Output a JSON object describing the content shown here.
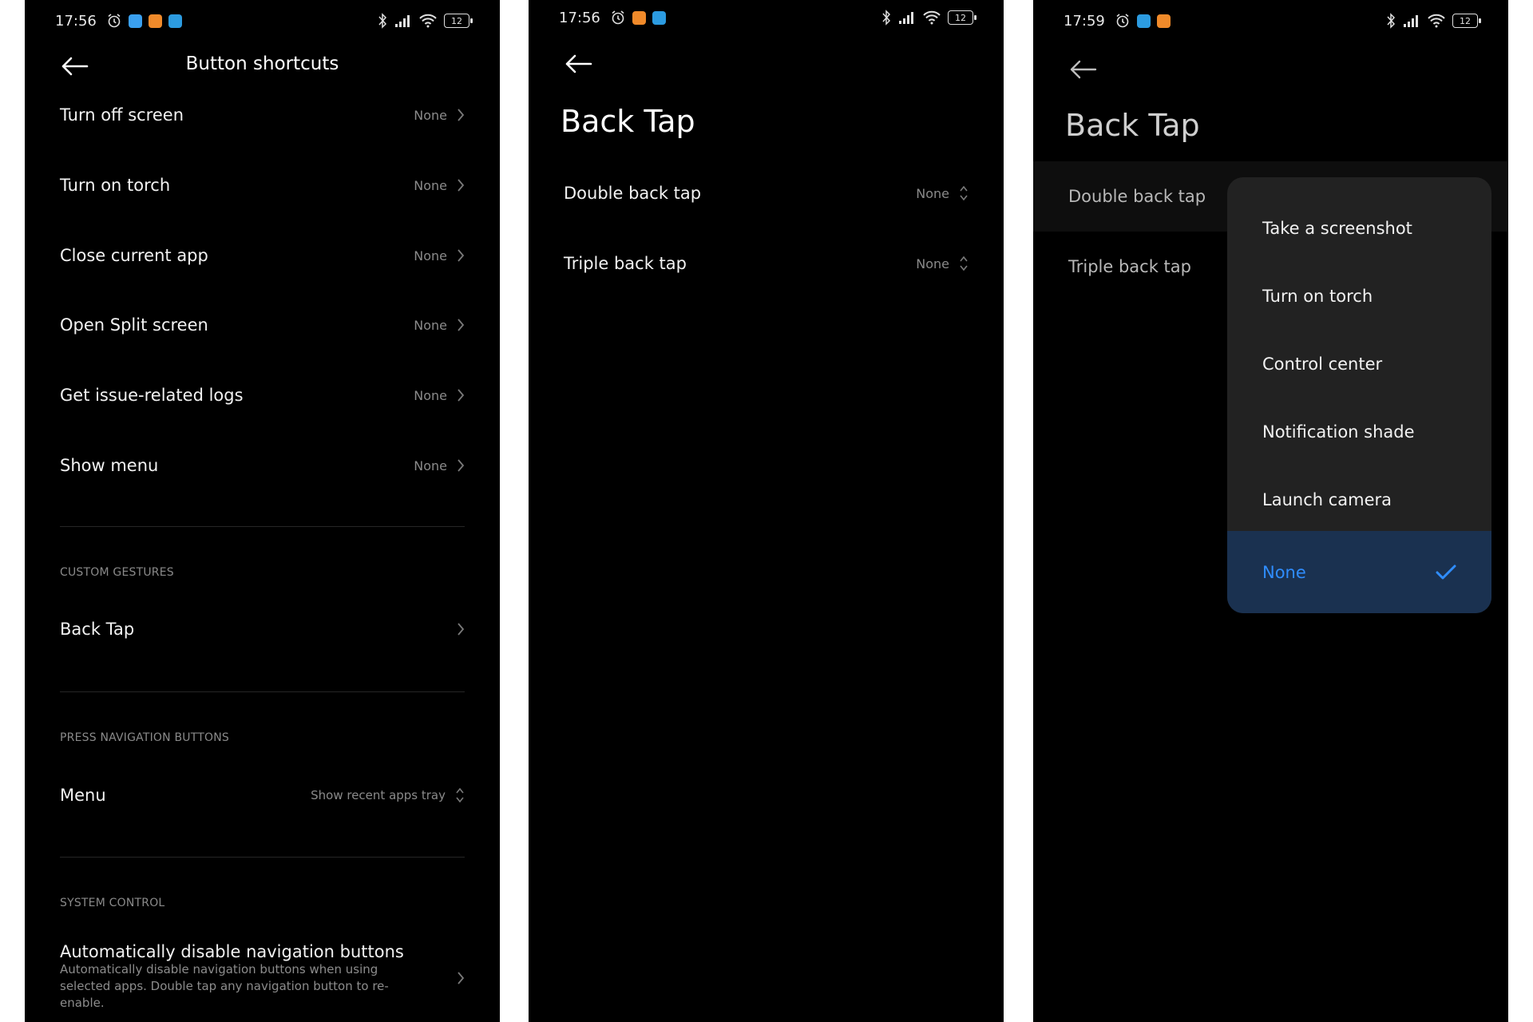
{
  "screens": [
    {
      "status_time": "17:56",
      "battery": "12",
      "title": "Button shortcuts",
      "items": [
        {
          "label": "Turn off screen",
          "value": "None"
        },
        {
          "label": "Turn on torch",
          "value": "None"
        },
        {
          "label": "Close current app",
          "value": "None"
        },
        {
          "label": "Open Split screen",
          "value": "None"
        },
        {
          "label": "Get issue-related logs",
          "value": "None"
        },
        {
          "label": "Show menu",
          "value": "None"
        }
      ],
      "custom_gestures": {
        "header": "CUSTOM GESTURES",
        "item": "Back Tap"
      },
      "press_nav": {
        "header": "PRESS NAVIGATION BUTTONS",
        "item": "Menu",
        "value": "Show recent apps tray"
      },
      "system_control": {
        "header": "SYSTEM CONTROL",
        "item": "Automatically disable navigation buttons",
        "description": "Automatically disable navigation buttons when using selected apps. Double tap any navigation button to re-enable."
      }
    },
    {
      "status_time": "17:56",
      "battery": "12",
      "title": "Back Tap",
      "items": [
        {
          "label": "Double back tap",
          "value": "None"
        },
        {
          "label": "Triple back tap",
          "value": "None"
        }
      ]
    },
    {
      "status_time": "17:59",
      "battery": "12",
      "title": "Back Tap",
      "items": [
        {
          "label": "Double back tap"
        },
        {
          "label": "Triple back tap"
        }
      ],
      "dropdown": {
        "options": [
          "Take a screenshot",
          "Turn on torch",
          "Control center",
          "Notification shade",
          "Launch camera"
        ],
        "selected": "None"
      }
    }
  ],
  "colors": {
    "background": "#000000",
    "text": "#f2f2f2",
    "secondary": "#8a8a8a",
    "dropdown_bg": "#222222",
    "selected_bg": "#1a3150",
    "accent": "#2f8dff"
  },
  "icons": {
    "status": [
      "alarm-icon",
      "bluetooth-icon",
      "signal-icon",
      "wifi-icon",
      "battery-icon"
    ],
    "navigation": [
      "back-arrow-icon",
      "chevron-right-icon",
      "up-down-chevron-icon",
      "checkmark-icon"
    ]
  }
}
